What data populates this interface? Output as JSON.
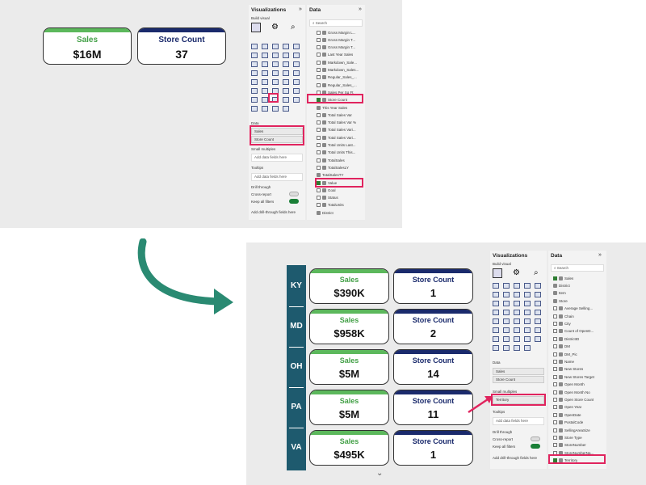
{
  "before": {
    "cards": [
      {
        "title": "Sales",
        "value": "$16M"
      },
      {
        "title": "Store Count",
        "value": "37"
      }
    ],
    "viz_title": "Visualizations",
    "build_visual": "Build visual",
    "data_title": "Data",
    "search_placeholder": "Search",
    "data_section": "Data",
    "fields": [
      "Sales",
      "Store Count"
    ],
    "small_multiples": "Small multiples",
    "tooltips": "Tooltips",
    "add_fields": "Add data fields here",
    "drill_through": "Drill through",
    "cross_report": "Cross-report",
    "cross_report_state": "Off",
    "keep_filters": "Keep all filters",
    "keep_filters_state": "On",
    "add_drill": "Add drill-through fields here",
    "data_items": [
      "Gross Margin L...",
      "Gross Margin T...",
      "Gross Margin T...",
      "Last Year Sales",
      "Markdown_Sale...",
      "Markdown_Sales...",
      "Regular_Sales_...",
      "Regular_Sales_...",
      "Sales Per Sq Ft",
      "Store Count",
      "This Year Sales",
      "Total Sales Var",
      "Total Sales Var %",
      "Total Sales Vari...",
      "Total Sales Vari...",
      "Total Units Last...",
      "Total Units This...",
      "TotalSales",
      "TotalSalesLY",
      "TotalSalesTY",
      "Value",
      "Goal",
      "Status",
      "TotalUnits",
      "District"
    ]
  },
  "after": {
    "rows": [
      {
        "label": "KY",
        "sales": "$390K",
        "count": "1"
      },
      {
        "label": "MD",
        "sales": "$958K",
        "count": "2"
      },
      {
        "label": "OH",
        "sales": "$5M",
        "count": "14"
      },
      {
        "label": "PA",
        "sales": "$5M",
        "count": "11"
      },
      {
        "label": "VA",
        "sales": "$495K",
        "count": "1"
      }
    ],
    "sales_title": "Sales",
    "count_title": "Store Count",
    "viz_title": "Visualizations",
    "build_visual": "Build visual",
    "data_title": "Data",
    "search_placeholder": "Search",
    "data_section": "Data",
    "fields": [
      "Sales",
      "Store Count"
    ],
    "small_multiples": "Small multiples",
    "territory": "Territory",
    "tooltips": "Tooltips",
    "add_fields": "Add data fields here",
    "drill_through": "Drill through",
    "cross_report": "Cross-report",
    "keep_filters": "Keep all filters",
    "add_drill": "Add drill-through fields here",
    "data_items": [
      "Sales",
      "District",
      "Item",
      "Store",
      "Average Selling...",
      "Chain",
      "City",
      "Count of OpenD...",
      "DistrictID",
      "DM",
      "DM_Pic",
      "Name",
      "New Stores",
      "New Stores Target",
      "Open Month",
      "Open Month No",
      "Open Store Count",
      "Open Year",
      "OpenDate",
      "PostalCode",
      "SellingAreaSize",
      "Store Type",
      "StoreNumber",
      "StoreNumberNa...",
      "Territory"
    ]
  },
  "colors": {
    "green": "#5cb85c",
    "navy": "#1a2a6c",
    "highlight": "#e0245e",
    "arrow": "#2a8a72",
    "band": "#1e5a6e"
  }
}
